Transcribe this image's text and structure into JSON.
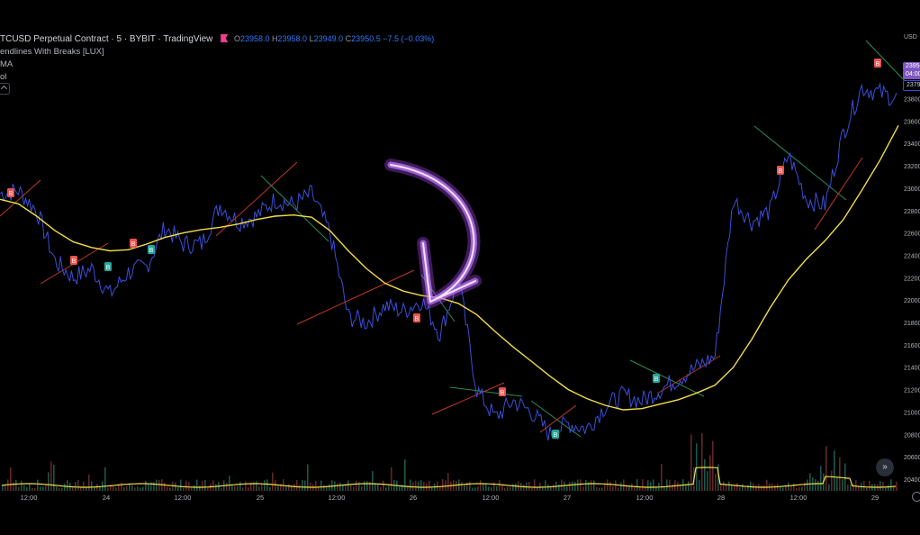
{
  "header": {
    "symbol": "TCUSD Perpetual Contract · 5 · BYBIT · TradingView",
    "open_label": "O",
    "open": "23958.0",
    "high_label": "H",
    "high": "23958.0",
    "low_label": "L",
    "low": "23949.0",
    "close_label": "C",
    "close": "23950.5",
    "change": "−7.5 (−0.03%)",
    "indicators": [
      "endlines With Breaks [LUX]",
      "MA",
      "ol"
    ]
  },
  "price_axis": {
    "currency": "USD",
    "ticks": [
      "24000",
      "23800",
      "23600",
      "23400",
      "23200",
      "23000",
      "22800",
      "22600",
      "22400",
      "22200",
      "22000",
      "21800",
      "21600",
      "21400",
      "21200",
      "21000",
      "20800",
      "20600",
      "20400"
    ],
    "current_price": "23950",
    "countdown": "04:00",
    "ma_value": "23791"
  },
  "time_axis": {
    "ticks": [
      "12:00",
      "24",
      "12:00",
      "25",
      "12:00",
      "26",
      "12:00",
      "27",
      "12:00",
      "28",
      "12:00",
      "29"
    ]
  },
  "colors": {
    "background": "#000000",
    "price_line": "#3b4ed8",
    "ma_line": "#f2de47",
    "upper_trendline": "#2e8b57",
    "lower_trendline": "#c0392b",
    "break_up_label": "#26a69a",
    "break_down_label": "#ef5350",
    "arrow_glow": "#b04dff",
    "volume_ma": "#f2de47"
  },
  "chart_data": {
    "type": "line",
    "title": "",
    "xlabel": "",
    "ylabel": "",
    "ylim": [
      20400,
      24150
    ],
    "x_ticks": [
      "12:00",
      "24",
      "12:00",
      "25",
      "12:00",
      "26",
      "12:00",
      "27",
      "12:00",
      "28",
      "12:00",
      "29"
    ],
    "series": [
      {
        "x": [
          0,
          4,
          8,
          12,
          16,
          20,
          24,
          28,
          32,
          36,
          40,
          44,
          48,
          52,
          56,
          60,
          64,
          68,
          72,
          76,
          80,
          84,
          88,
          92,
          96,
          100,
          104,
          108,
          112,
          116,
          120,
          124,
          128,
          132,
          136,
          140,
          144,
          148,
          152,
          156,
          160,
          164,
          168,
          172,
          176,
          180,
          184,
          188,
          192,
          196
        ],
        "values": [
          22950,
          22980,
          22800,
          22350,
          22200,
          22280,
          22050,
          22250,
          22300,
          22650,
          22500,
          22500,
          22850,
          22700,
          22750,
          22900,
          22850,
          22950,
          22600,
          21850,
          21800,
          21950,
          21900,
          22000,
          21700,
          22200,
          21200,
          20950,
          21100,
          21000,
          20800,
          20900,
          20850,
          21050,
          21150,
          21100,
          21200,
          21300,
          21400,
          21500,
          22900,
          22700,
          22800,
          23300,
          22900,
          22850,
          23500,
          23900,
          23850,
          23800
        ]
      },
      {
        "x": [
          0,
          4,
          8,
          12,
          16,
          20,
          24,
          28,
          32,
          36,
          40,
          44,
          48,
          52,
          56,
          60,
          64,
          68,
          72,
          76,
          80,
          84,
          88,
          92,
          96,
          100,
          104,
          108,
          112,
          116,
          120,
          124,
          128,
          132,
          136,
          140,
          144,
          148,
          152,
          156,
          160,
          164,
          168,
          172,
          176,
          180,
          184,
          188,
          192,
          196
        ],
        "values": [
          22900,
          22860,
          22750,
          22620,
          22520,
          22470,
          22440,
          22450,
          22500,
          22560,
          22600,
          22630,
          22650,
          22680,
          22720,
          22750,
          22760,
          22740,
          22620,
          22440,
          22280,
          22150,
          22080,
          22040,
          22020,
          21970,
          21870,
          21720,
          21580,
          21450,
          21320,
          21200,
          21120,
          21060,
          21020,
          21030,
          21070,
          21110,
          21170,
          21240,
          21400,
          21650,
          21930,
          22180,
          22370,
          22530,
          22720,
          22980,
          23250,
          23560
        ]
      }
    ],
    "break_labels": [
      {
        "text": "B",
        "type": "down",
        "x": 3
      },
      {
        "text": "B",
        "type": "down",
        "x": 20
      },
      {
        "text": "B",
        "type": "up",
        "x": 29
      },
      {
        "text": "B",
        "type": "down",
        "x": 36
      },
      {
        "text": "B",
        "type": "up",
        "x": 40
      },
      {
        "text": "B",
        "type": "down",
        "x": 108
      },
      {
        "text": "B",
        "type": "down",
        "x": 131
      },
      {
        "text": "B",
        "type": "up",
        "x": 145
      },
      {
        "text": "B",
        "type": "up",
        "x": 171
      },
      {
        "text": "B",
        "type": "down",
        "x": 203
      },
      {
        "text": "B",
        "type": "down",
        "x": 229
      }
    ]
  }
}
